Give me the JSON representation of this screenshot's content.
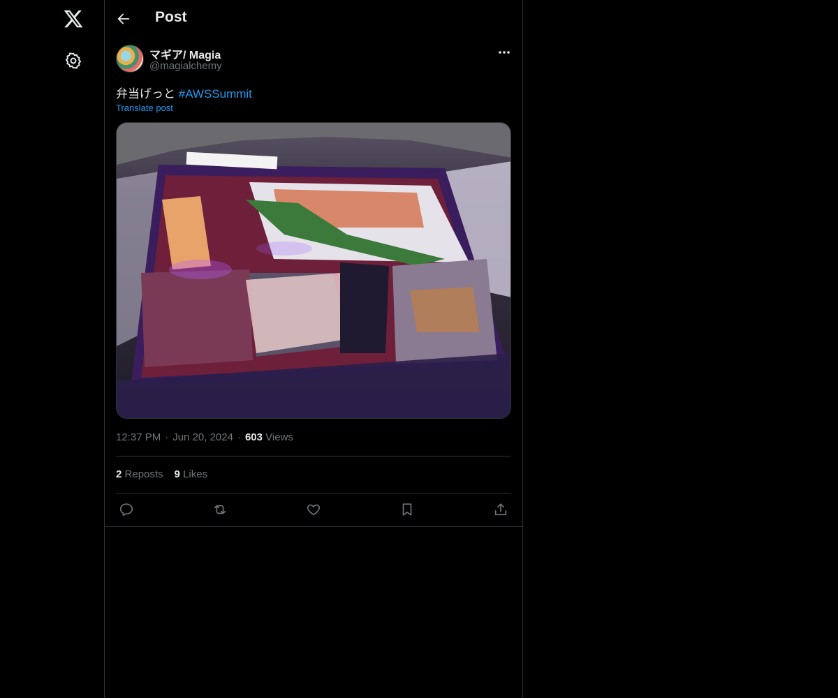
{
  "header": {
    "title": "Post"
  },
  "author": {
    "display_name": "マギア/ Magia",
    "handle": "@magialchemy"
  },
  "post": {
    "text": "弁当げっと",
    "hashtag": "#AWSSummit",
    "translate_label": "Translate post",
    "time": "12:37 PM",
    "date": "Jun 20, 2024",
    "views_count": "603",
    "views_label": "Views",
    "reposts_count": "2",
    "reposts_label": "Reposts",
    "likes_count": "9",
    "likes_label": "Likes"
  },
  "icons": {
    "logo": "x-logo-icon",
    "settings": "gear-icon",
    "back": "arrow-left-icon",
    "more": "more-horizontal-icon",
    "reply": "reply-icon",
    "repost": "repost-icon",
    "like": "heart-icon",
    "bookmark": "bookmark-icon",
    "share": "share-icon"
  },
  "colors": {
    "background": "#000000",
    "text": "#e7e9ea",
    "secondary": "#71767b",
    "accent": "#1d9bf0",
    "border": "#2f3336"
  }
}
